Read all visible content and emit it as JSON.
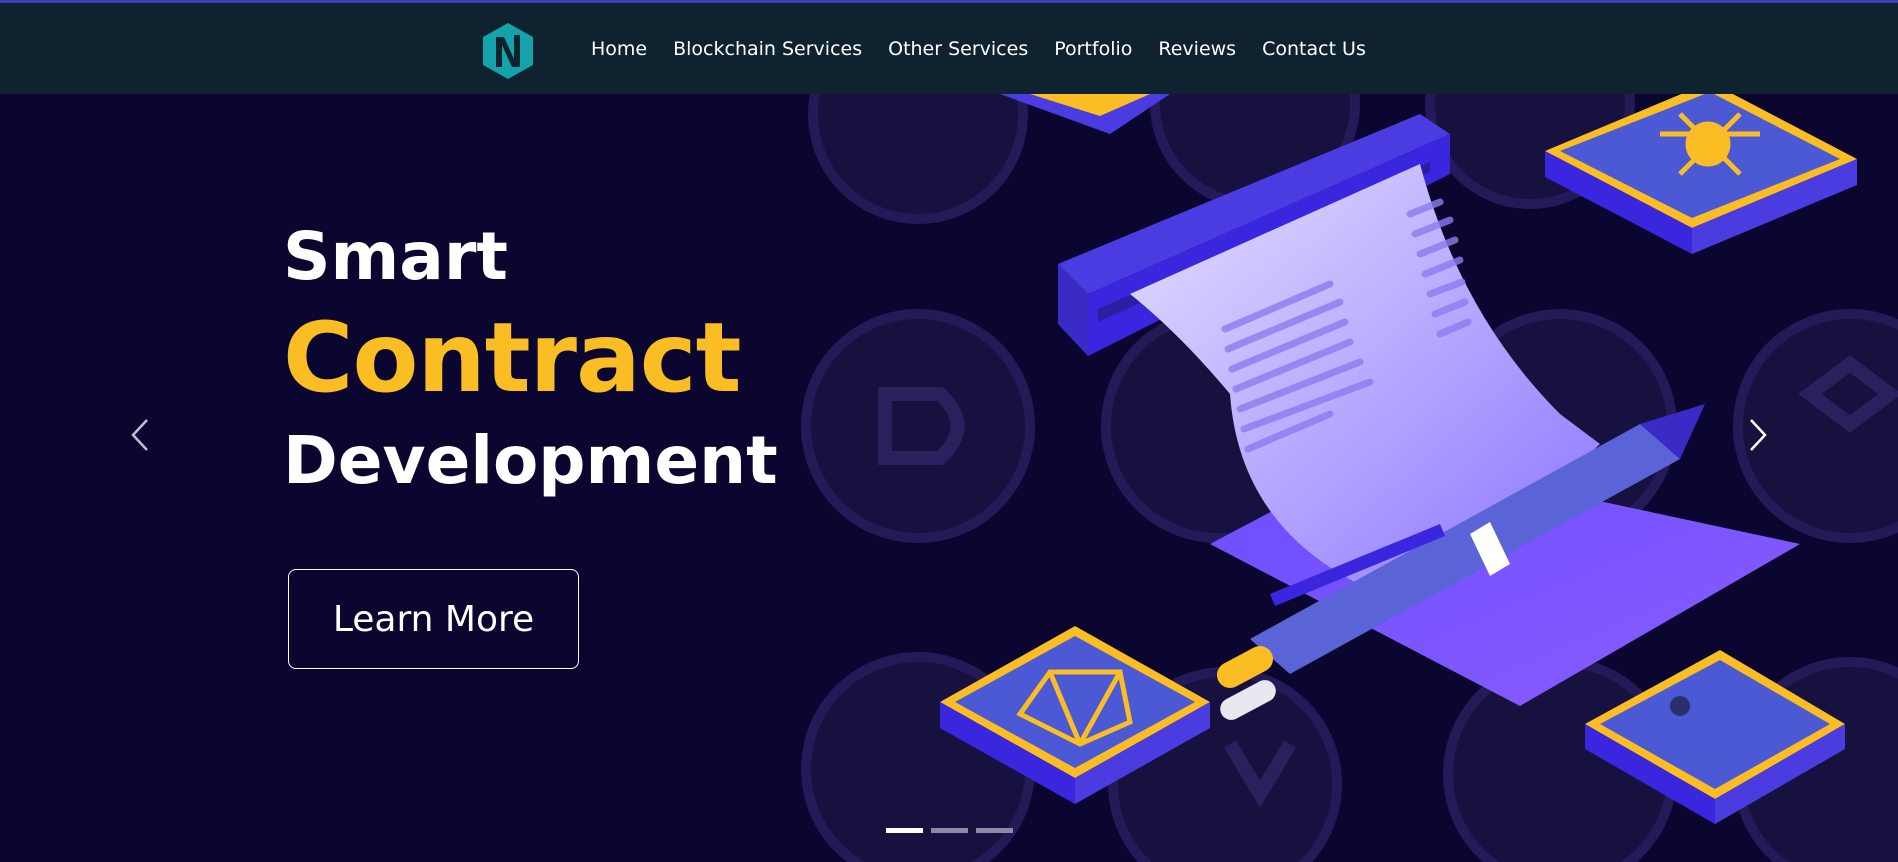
{
  "nav": {
    "logo_icon": "hexagon-n-logo",
    "items": [
      {
        "label": "Home"
      },
      {
        "label": "Blockchain Services"
      },
      {
        "label": "Other Services"
      },
      {
        "label": "Portfolio"
      },
      {
        "label": "Reviews"
      },
      {
        "label": "Contact Us"
      }
    ]
  },
  "hero": {
    "title_line1": "Smart",
    "title_line2": "Contract",
    "title_line3": "Development",
    "cta_label": "Learn More",
    "prev_icon": "chevron-left-icon",
    "next_icon": "chevron-right-icon",
    "slides_total": 3,
    "active_slide": 1
  },
  "colors": {
    "navbar_bg": "#0f2230",
    "hero_bg": "#0b0630",
    "accent_yellow": "#fbbd24",
    "logo_teal": "#14a3a9",
    "illustration_purple": "#4a3ce0"
  }
}
